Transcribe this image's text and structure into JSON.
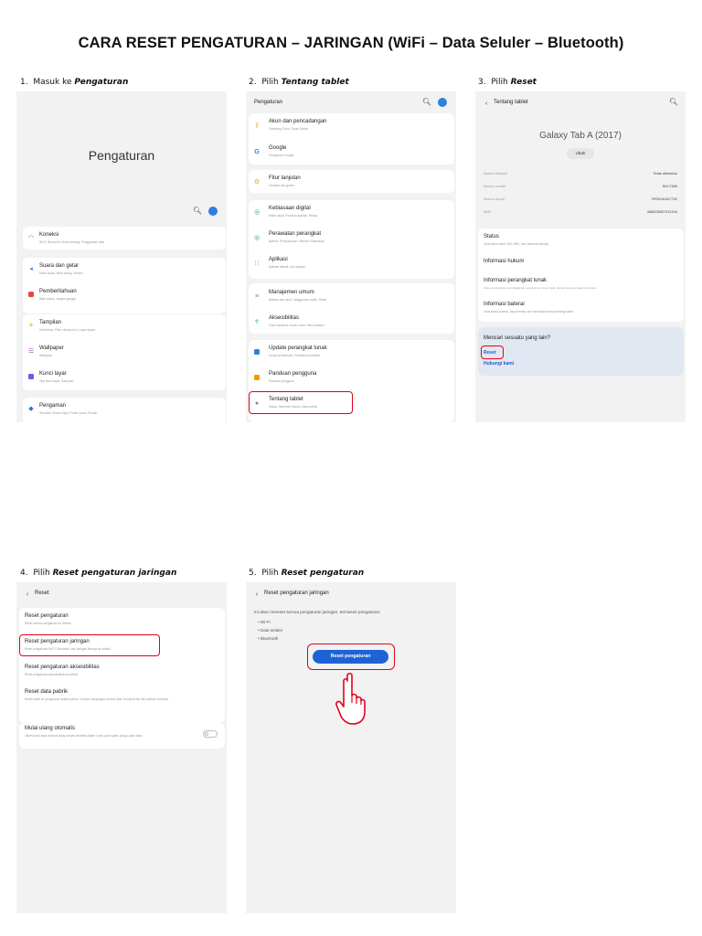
{
  "title": "CARA RESET PENGATURAN – JARINGAN (WiFi – Data Seluler – Bluetooth)",
  "steps": [
    {
      "num": "1.",
      "text": "Masuk ke ",
      "emph": "Pengaturan"
    },
    {
      "num": "2.",
      "text": "Pilih ",
      "emph": "Tentang tablet"
    },
    {
      "num": "3.",
      "text": "Pilih ",
      "emph": "Reset"
    },
    {
      "num": "4.",
      "text": "Pilih ",
      "emph": "Reset pengaturan jaringan"
    },
    {
      "num": "5.",
      "text": "Pilih ",
      "emph": "Reset pengaturan"
    }
  ],
  "screen1": {
    "big_title": "Pengaturan",
    "items": [
      {
        "label": "Koneksi",
        "sub": "Wi-Fi, Bluetooth, Mode terbang, Penggunaan data",
        "icon": "wifi-icon",
        "color": "#2f7fe0"
      },
      {
        "label": "Suara dan getar",
        "sub": "Mode suara, Mute dering, Volume",
        "icon": "speaker-icon",
        "color": "#2f7fe0"
      },
      {
        "label": "Pemberitahuan",
        "sub": "Bilah status, Jangan ganggu",
        "icon": "bell-icon",
        "color": "#e24b3b"
      },
      {
        "label": "Tampilan",
        "sub": "Kecerahan, Filter cahaya biru, Layar depan",
        "icon": "sun-icon",
        "color": "#f1b500"
      },
      {
        "label": "Wallpaper",
        "sub": "Wallpaper",
        "icon": "brush-icon",
        "color": "#b24fc8"
      },
      {
        "label": "Kunci layar",
        "sub": "Tipe kunci layar, Gaya jam",
        "icon": "lock-icon",
        "color": "#6a5be0"
      },
      {
        "label": "Pengaman",
        "sub": "Temukan Ponsel Saya, Folder Aman, Privasi",
        "icon": "shield-icon",
        "color": "#2f6fe0"
      }
    ]
  },
  "screen2": {
    "header": "Pengaturan",
    "items": [
      {
        "label": "Akun dan pencadangan",
        "sub": "Samsung Cloud, Smart Switch",
        "icon": "key-icon",
        "color": "#f1b500"
      },
      {
        "label": "Google",
        "sub": "Pengaturan Google",
        "icon": "google-icon",
        "color": "#2f7fe0"
      },
      {
        "label": "Fitur lanjutan",
        "sub": "Gerakan dan gestur",
        "icon": "gear-plus-icon",
        "color": "#f1a100"
      },
      {
        "label": "Kebiasaan digital",
        "sub": "Waktu layar, Pewaktu aplikasi, Redup",
        "icon": "habit-icon",
        "color": "#27a55b"
      },
      {
        "label": "Perawatan perangkat",
        "sub": "Baterai, Penyimpanan, Memori, Keamanan",
        "icon": "care-icon",
        "color": "#27a55b"
      },
      {
        "label": "Aplikasi",
        "sub": "Aplikasi default, Izin aplikasi",
        "icon": "apps-icon",
        "color": "#2f7fe0"
      },
      {
        "label": "Manajemen umum",
        "sub": "Bahasa dan input, Tanggal dan waktu, Reset",
        "icon": "sliders-icon",
        "color": "#7a8aa0"
      },
      {
        "label": "Aksesibilitas",
        "sub": "Voice Assistant, Audio mono, Menu asisten",
        "icon": "accessibility-icon",
        "color": "#27a55b"
      },
      {
        "label": "Update perangkat lunak",
        "sub": "Unduh pembaruan, Pembaruan terakhir",
        "icon": "update-icon",
        "color": "#2f7fe0"
      },
      {
        "label": "Panduan pengguna",
        "sub": "Panduan pengguna",
        "icon": "guide-icon",
        "color": "#f19a00"
      },
      {
        "label": "Tentang tablet",
        "sub": "Status, Informasi hukum, Nama tablet",
        "icon": "info-icon",
        "color": "#8a8a8a"
      }
    ]
  },
  "screen3": {
    "header": "Tentang tablet",
    "device": "Galaxy Tab A (2017)",
    "edit": "Ubah",
    "info": [
      {
        "k": "Nomor telepon",
        "v": "Tidak diketahui"
      },
      {
        "k": "Nomor model",
        "v": "SM-T385"
      },
      {
        "k": "Nomor serial",
        "v": "RR2KA00CT3Z"
      },
      {
        "k": "IMEI",
        "v": "358525087913194"
      }
    ],
    "items": [
      {
        "label": "Status",
        "sub": "Lihat status kartu SIM, IMEI, dan informasi lainnya"
      },
      {
        "label": "Informasi hukum",
        "sub": ""
      },
      {
        "label": "Informasi perangkat lunak",
        "sub": "Lihat versi Android, versi baseband, versi kernel, nomor build, dan lainnya yang saat ini terinstal"
      },
      {
        "label": "Informasi baterai",
        "sub": "Lihat status baterai, daya tersisa, dan informasi lainnya tentang tablet"
      }
    ],
    "search_title": "Mencari sesuatu yang lain?",
    "link_reset": "Reset",
    "link_contact": "Hubungi kami"
  },
  "screen4": {
    "header": "Reset",
    "items": [
      {
        "label": "Reset pengaturan",
        "sub": "Reset semua pengaturan ke default"
      },
      {
        "label": "Reset pengaturan jaringan",
        "sub": "Reset pengaturan Wi-Fi, Bluetooth, dan jaringan lainnya ke default"
      },
      {
        "label": "Reset pengaturan aksesibilitas",
        "sub": "Reset pengaturan aksesibilitas ke default"
      },
      {
        "label": "Reset data pabrik",
        "sub": "Reset tablet ke pengaturan default pabrik. Ini akan menghapus semua data, termasuk file dan aplikasi unduhan."
      }
    ],
    "auto_label": "Mulai ulang otomatis",
    "auto_sub": "Tablet Anda akan dimulai ulang secara otomatis dalam 1 jam pada waktu yang sudah diatur"
  },
  "screen5": {
    "header": "Reset pengaturan jaringan",
    "desc": "Ini akan mereset semua pengaturan jaringan, termasuk pengaturan:",
    "bullets": [
      "• Wi-Fi",
      "• Data seluler",
      "• Bluetooth"
    ],
    "button": "Reset pengaturan"
  }
}
